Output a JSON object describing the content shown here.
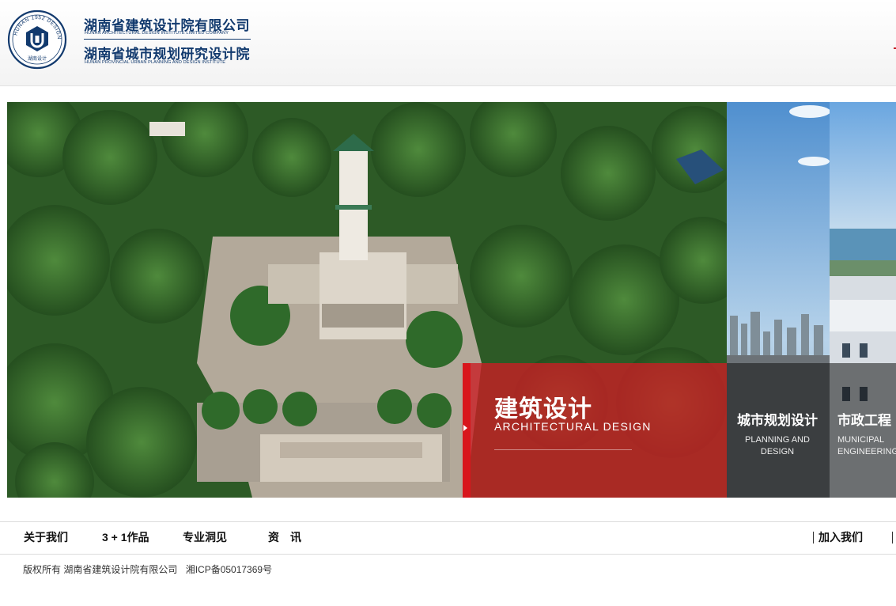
{
  "header": {
    "seal_text": "HUNAN 1952 DESIGN",
    "seal_cn": "湖南设计",
    "company_cn": "湖南省建筑设计院有限公司",
    "company_en": "HUNAN ARCHITECTURAL DESIGN INSTITUTE LIMITED COMPANY",
    "institute_cn": "湖南省城市规划研究设计院",
    "institute_en": "HUNAN PROVINCIAL URBAN PLANNING AND DESIGN INSTITUTE"
  },
  "banner": {
    "main": {
      "title_cn": "建筑设计",
      "title_en": "ARCHITECTURAL  DESIGN"
    },
    "slots": [
      {
        "title_cn": "城市规划设计",
        "title_en_1": "PLANNING AND",
        "title_en_2": "DESIGN"
      },
      {
        "title_cn": "市政工程",
        "title_en_1": "MUNICIPAL",
        "title_en_2": "ENGINEERING"
      }
    ]
  },
  "nav": {
    "items": [
      "关于我们",
      "3 + 1作品",
      "专业洞见",
      "资　讯"
    ],
    "join": "加入我们"
  },
  "footer": {
    "copyright": "版权所有 湖南省建筑设计院有限公司",
    "icp": "湘ICP备05017369号"
  },
  "colors": {
    "brand_blue": "#123a6e",
    "accent_red": "#d8161c"
  },
  "icons": [
    "seal-logo-icon",
    "play-arrow-icon"
  ]
}
